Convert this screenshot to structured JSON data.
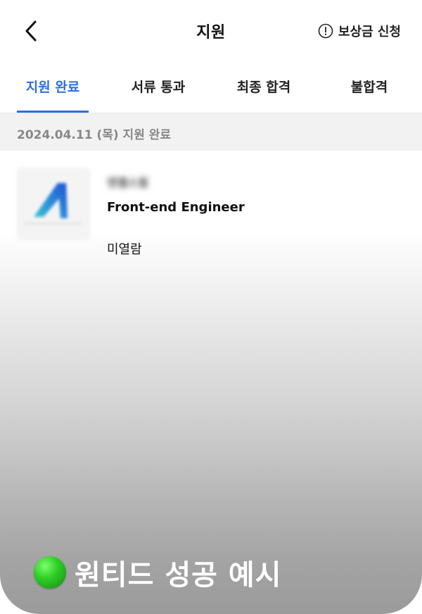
{
  "header": {
    "title": "지원",
    "back_icon": "chevron-left-icon",
    "reward_icon": "alert-circle-icon",
    "reward_label": "보상금 신청"
  },
  "tabs": [
    {
      "label": "지원 완료",
      "active": true
    },
    {
      "label": "서류 통과",
      "active": false
    },
    {
      "label": "최종 합격",
      "active": false
    },
    {
      "label": "불합격",
      "active": false
    }
  ],
  "date_group": {
    "label": "2024.04.11 (목) 지원 완료"
  },
  "application": {
    "company": "엔젤스웜",
    "position": "Front-end Engineer",
    "status": "미열람"
  },
  "caption": {
    "icon": "green-circle-icon",
    "text": "원티드 성공 예시"
  },
  "colors": {
    "accent": "#2b6fe0",
    "date_strip": "#f2f2f2"
  }
}
